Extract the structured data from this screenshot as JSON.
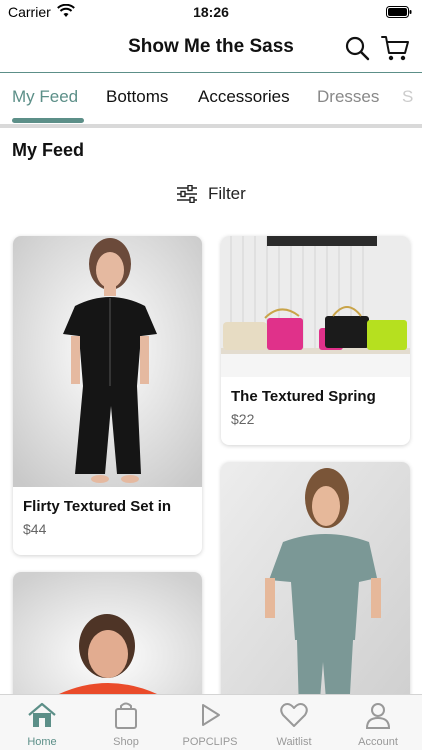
{
  "status_bar": {
    "carrier": "Carrier",
    "time": "18:26"
  },
  "header": {
    "title": "Show Me the Sass"
  },
  "tabs": [
    {
      "label": "My Feed",
      "active": true
    },
    {
      "label": "Bottoms",
      "active": false
    },
    {
      "label": "Accessories",
      "active": false
    },
    {
      "label": "Dresses",
      "active": false
    },
    {
      "label": "S",
      "active": false
    }
  ],
  "feed": {
    "title": "My Feed",
    "filter_label": "Filter"
  },
  "products": [
    {
      "name": "Flirty Textured Set in",
      "price": "$44"
    },
    {
      "name": "The Textured Spring",
      "price": "$22"
    },
    {
      "name": "",
      "price": ""
    },
    {
      "name": "",
      "price": ""
    }
  ],
  "bottom_nav": [
    {
      "label": "Home",
      "icon": "home-icon",
      "active": true
    },
    {
      "label": "Shop",
      "icon": "shopping-bag-icon",
      "active": false
    },
    {
      "label": "POPCLIPS",
      "icon": "play-icon",
      "active": false
    },
    {
      "label": "Waitlist",
      "icon": "heart-icon",
      "active": false
    },
    {
      "label": "Account",
      "icon": "person-icon",
      "active": false
    }
  ],
  "colors": {
    "accent": "#5c8f88",
    "inactive": "#999999"
  }
}
